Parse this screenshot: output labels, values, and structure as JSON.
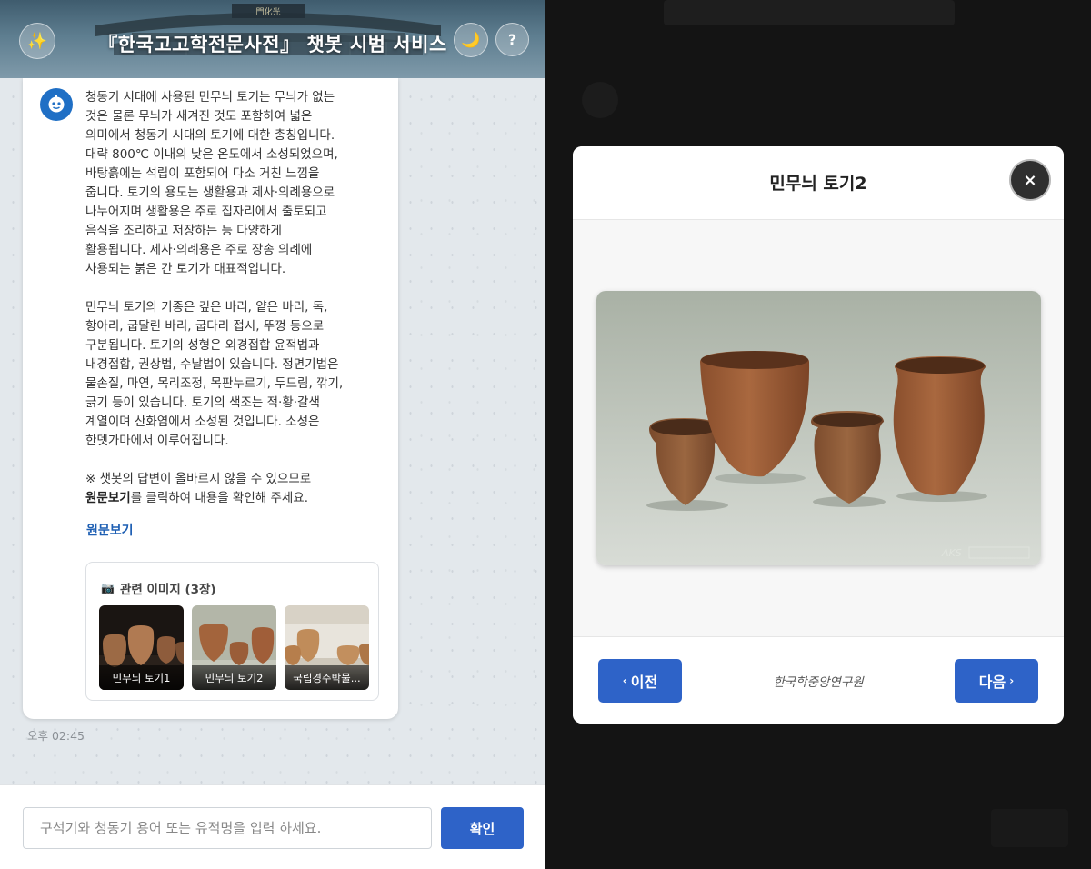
{
  "chat": {
    "header": {
      "title": "『한국고고학전문사전』 챗봇 시범 서비스",
      "left_icon": "sparkle-icon",
      "theme_icon": "moon-icon",
      "help_label": "?",
      "gate_sign": "門化光"
    },
    "message": {
      "avatar_icon": "bot-icon",
      "paragraphs": [
        "청동기 시대에 사용된 민무늬 토기는 무늬가 없는\n것은 물론 무늬가 새겨진 것도 포함하여 넓은\n의미에서 청동기 시대의 토기에 대한 총칭입니다.\n대략 800℃ 이내의 낮은 온도에서 소성되었으며,\n바탕흙에는 석립이 포함되어 다소 거친 느낌을\n줍니다. 토기의 용도는 생활용과 제사·의례용으로\n나누어지며 생활용은 주로 집자리에서 출토되고\n음식을 조리하고 저장하는 등 다양하게\n활용됩니다. 제사·의례용은 주로 장송 의례에\n사용되는 붉은 간 토기가 대표적입니다.",
        "민무늬 토기의 기종은 깊은 바리, 얕은 바리, 독,\n항아리, 굽달린 바리, 굽다리 접시, 뚜껑 등으로\n구분됩니다. 토기의 성형은 외경접합 윤적법과\n내경접합, 권상법, 수날법이 있습니다. 정면기법은\n물손질, 마연, 목리조정, 목판누르기, 두드림, 깎기,\n긁기 등이 있습니다. 토기의 색조는 적·황·갈색\n계열이며 산화염에서 소성된 것입니다. 소성은\n한뎃가마에서 이루어집니다."
      ],
      "notice_line1": "※ 챗봇의 답변이 올바르지 않을 수 있으므로",
      "notice_bold": "원문보기",
      "notice_rest": "를 클릭하여 내용을 확인해 주세요.",
      "source_link": "원문보기",
      "images_title": "관련 이미지 (3장)",
      "images_icon": "camera-icon",
      "images": [
        {
          "label": "민무늬 토기1"
        },
        {
          "label": "민무늬 토기2"
        },
        {
          "label": "국립경주박물..."
        }
      ],
      "time": "오후 02:45"
    },
    "input": {
      "placeholder": "구석기와 청동기 용어 또는 유적명을 입력 하세요.",
      "value": "",
      "submit_label": "확인"
    }
  },
  "modal": {
    "title": "민무늬 토기2",
    "close_label": "×",
    "prev_label": "이전",
    "next_label": "다음",
    "prev_icon": "chevron-left-icon",
    "next_icon": "chevron-right-icon",
    "credit": "한국학중앙연구원"
  }
}
